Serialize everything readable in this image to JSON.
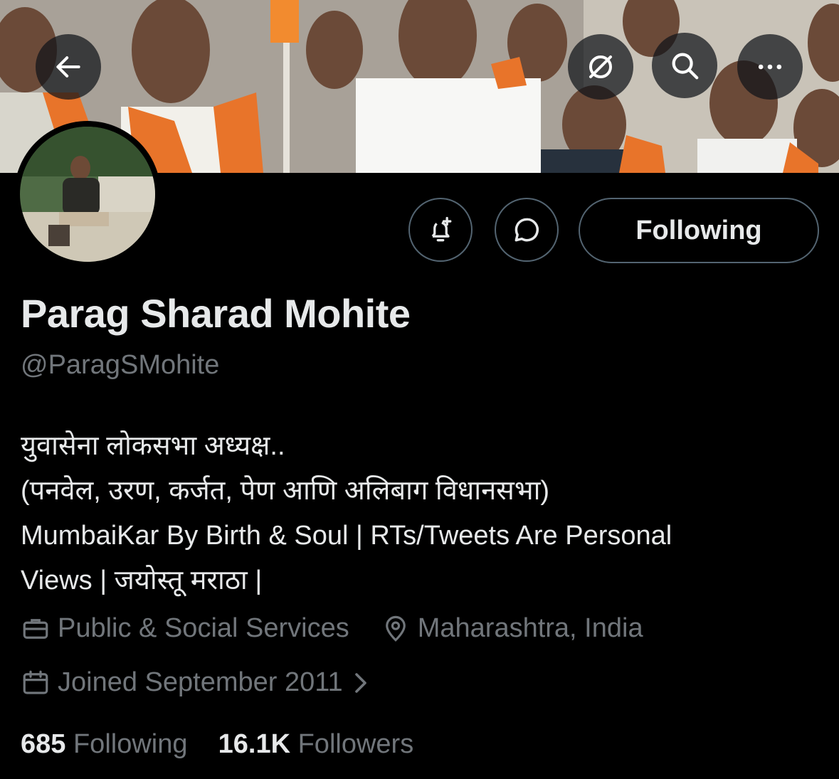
{
  "header": {
    "back_icon": "arrow-left-icon",
    "translate_icon": "translate-icon",
    "search_icon": "search-icon",
    "more_icon": "more-horizontal-icon"
  },
  "actions": {
    "notify_icon": "bell-plus-icon",
    "message_icon": "message-bubble-icon",
    "following_label": "Following"
  },
  "profile": {
    "name": "Parag Sharad Mohite",
    "handle": "@ParagSMohite",
    "bio_lines": [
      "युवासेना लोकसभा अध्यक्ष..",
      "(पनवेल, उरण, कर्जत, पेण आणि अलिबाग विधानसभा)",
      "MumbaiKar By Birth & Soul | RTs/Tweets Are Personal",
      "Views | जयोस्तू मराठा |"
    ],
    "category": "Public & Social Services",
    "location": "Maharashtra, India",
    "joined": "Joined September 2011"
  },
  "stats": {
    "following_count": "685",
    "following_label": "Following",
    "followers_count": "16.1K",
    "followers_label": "Followers"
  },
  "colors": {
    "background": "#000000",
    "text": "#e7e9ea",
    "muted": "#71767b",
    "border": "#536471",
    "accent_orange": "#e8742a"
  }
}
